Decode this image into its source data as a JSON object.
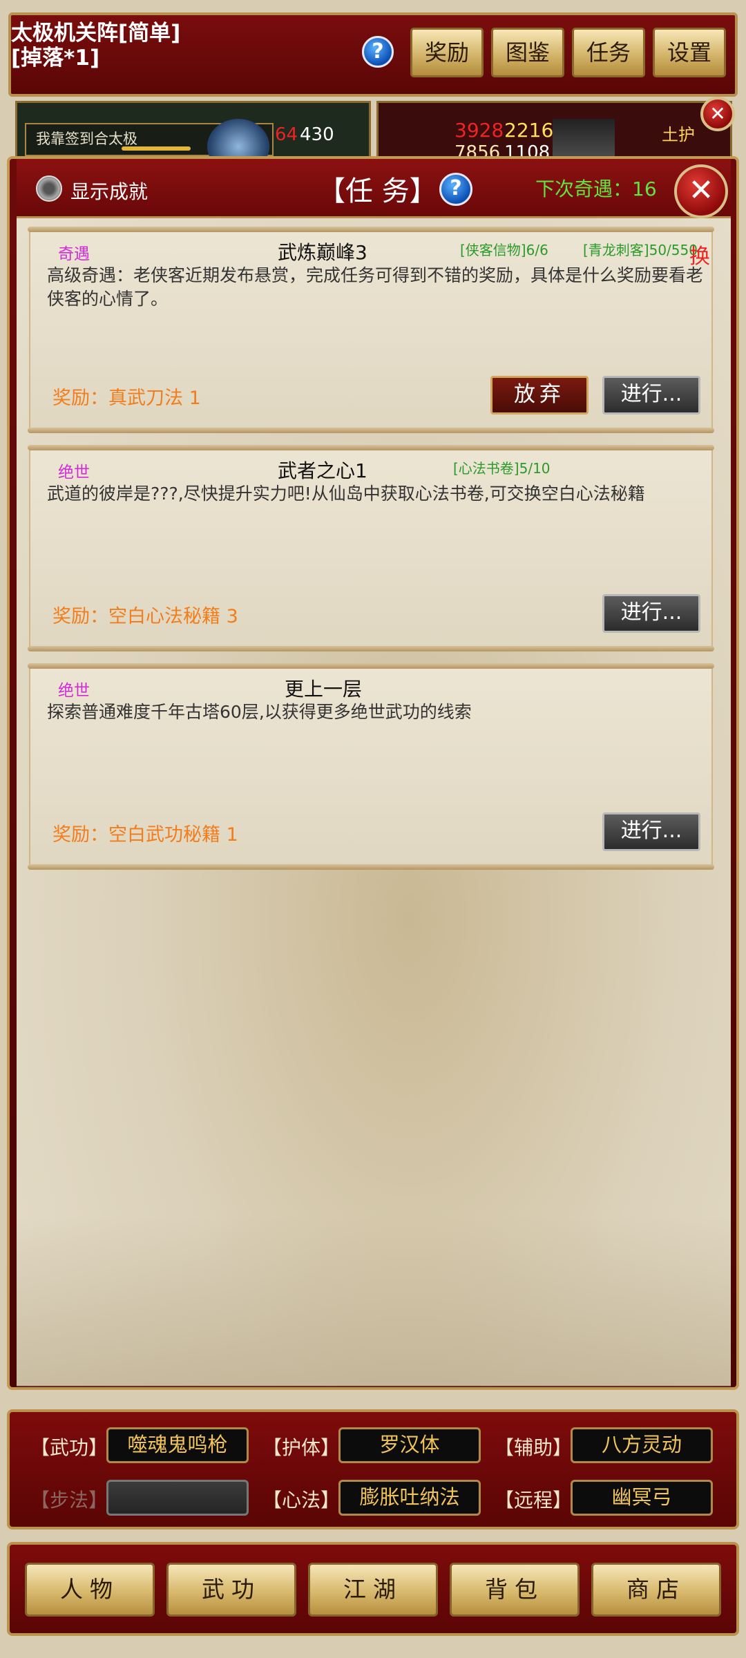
{
  "topbar": {
    "stage_title": "太极机关阵[简单]\n[掉落*1]",
    "help": "?",
    "buttons": [
      "奖励",
      "图鉴",
      "任务",
      "设置"
    ]
  },
  "strip": {
    "hint": "我靠签到合太极",
    "hint_num_red": "64",
    "hint_num_white": "430",
    "stat1_red": "3928",
    "stat1_yellow": "2216",
    "stat2_a": "7856",
    "stat2_b": "1108",
    "guard_label": "土护",
    "close": "✕"
  },
  "panel": {
    "show_achievement": "显示成就",
    "title": "【任 务】",
    "help": "?",
    "next_encounter": "下次奇遇：16",
    "close": "✕"
  },
  "quests": [
    {
      "category": "奇遇",
      "name": "武炼巅峰3",
      "cond1": "[侠客信物]6/6",
      "cond2": "[青龙刺客]50/550",
      "swap": "换",
      "desc": "高级奇遇：老侠客近期发布悬赏，完成任务可得到不错的奖励，具体是什么奖励要看老侠客的心情了。",
      "reward_label": "奖励：",
      "reward": "真武刀法 1",
      "giveup": "放弃",
      "go": "进行..."
    },
    {
      "category": "绝世",
      "name": "武者之心1",
      "cond1": "[心法书卷]5/10",
      "desc": "武道的彼岸是???,尽快提升实力吧!从仙岛中获取心法书卷,可交换空白心法秘籍",
      "reward_label": "奖励：",
      "reward": "空白心法秘籍 3",
      "go": "进行..."
    },
    {
      "category": "绝世",
      "name": "更上一层",
      "desc": "探索普通难度千年古塔60层,以获得更多绝世武功的线索",
      "reward_label": "奖励：",
      "reward": "空白武功秘籍 1",
      "go": "进行..."
    }
  ],
  "skills": {
    "row1": [
      {
        "label": "【武功】",
        "value": "噬魂鬼鸣枪"
      },
      {
        "label": "【护体】",
        "value": "罗汉体"
      },
      {
        "label": "【辅助】",
        "value": "八方灵动"
      }
    ],
    "row2": [
      {
        "label": "【步法】",
        "value": ""
      },
      {
        "label": "【心法】",
        "value": "膨胀吐纳法"
      },
      {
        "label": "【远程】",
        "value": "幽冥弓"
      }
    ]
  },
  "nav": [
    "人物",
    "武功",
    "江湖",
    "背包",
    "商店"
  ],
  "colors": {
    "accent_red": "#6a0808",
    "gold": "#d8b96d",
    "reward_orange": "#f17d1c",
    "category_magenta": "#d02bd7",
    "condition_green": "#2a9a2a",
    "encounter_green": "#60e440"
  }
}
